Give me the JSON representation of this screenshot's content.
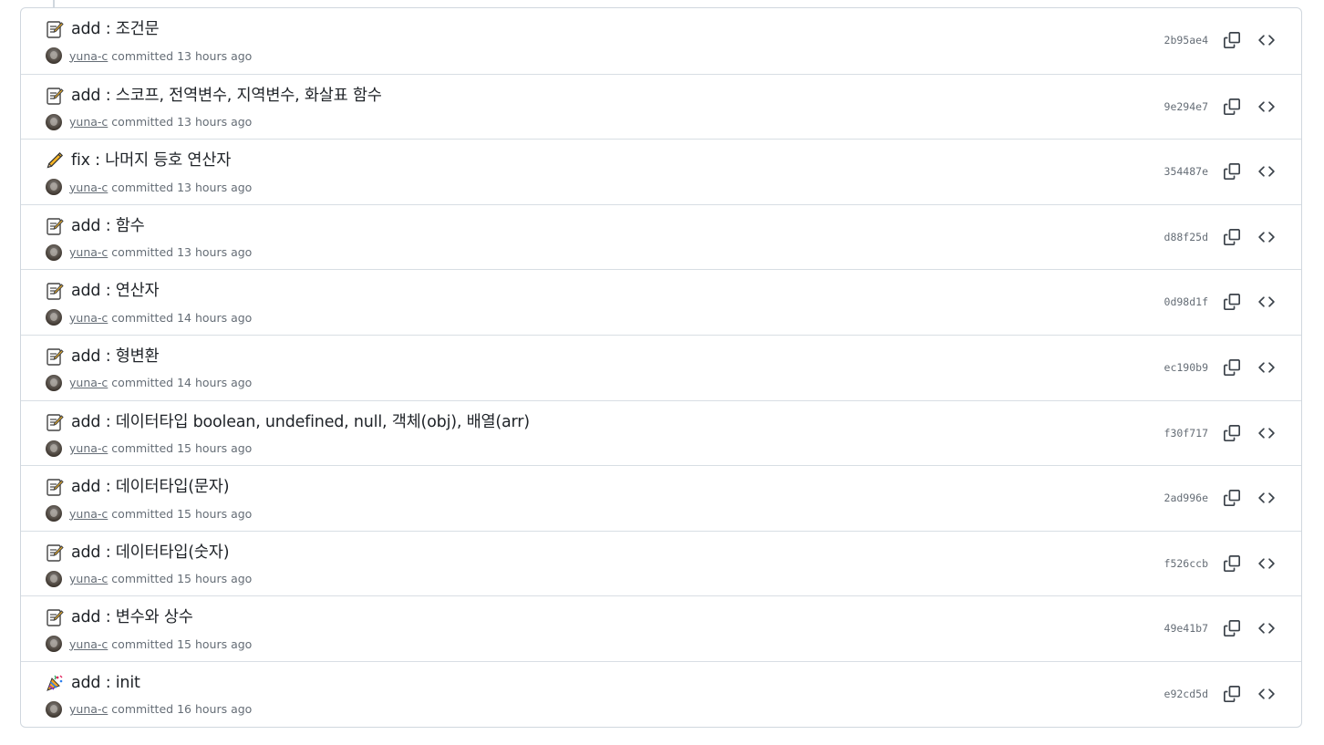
{
  "commits": [
    {
      "emoji": "memo-icon",
      "title": "add : 조건문",
      "author": "yuna-c",
      "verb": "committed",
      "time": "13 hours ago",
      "sha": "2b95ae4"
    },
    {
      "emoji": "memo-icon",
      "title": "add : 스코프, 전역변수, 지역변수, 화살표 함수",
      "author": "yuna-c",
      "verb": "committed",
      "time": "13 hours ago",
      "sha": "9e294e7"
    },
    {
      "emoji": "pencil-icon",
      "title": "fix : 나머지 등호 연산자",
      "author": "yuna-c",
      "verb": "committed",
      "time": "13 hours ago",
      "sha": "354487e"
    },
    {
      "emoji": "memo-icon",
      "title": "add : 함수",
      "author": "yuna-c",
      "verb": "committed",
      "time": "13 hours ago",
      "sha": "d88f25d"
    },
    {
      "emoji": "memo-icon",
      "title": "add : 연산자",
      "author": "yuna-c",
      "verb": "committed",
      "time": "14 hours ago",
      "sha": "0d98d1f"
    },
    {
      "emoji": "memo-icon",
      "title": "add : 형변환",
      "author": "yuna-c",
      "verb": "committed",
      "time": "14 hours ago",
      "sha": "ec190b9"
    },
    {
      "emoji": "memo-icon",
      "title": "add : 데이터타입 boolean, undefined, null, 객체(obj), 배열(arr)",
      "author": "yuna-c",
      "verb": "committed",
      "time": "15 hours ago",
      "sha": "f30f717"
    },
    {
      "emoji": "memo-icon",
      "title": "add : 데이터타입(문자)",
      "author": "yuna-c",
      "verb": "committed",
      "time": "15 hours ago",
      "sha": "2ad996e"
    },
    {
      "emoji": "memo-icon",
      "title": "add : 데이터타입(숫자)",
      "author": "yuna-c",
      "verb": "committed",
      "time": "15 hours ago",
      "sha": "f526ccb"
    },
    {
      "emoji": "memo-icon",
      "title": "add : 변수와 상수",
      "author": "yuna-c",
      "verb": "committed",
      "time": "15 hours ago",
      "sha": "49e41b7"
    },
    {
      "emoji": "party-popper-icon",
      "title": "add : init",
      "author": "yuna-c",
      "verb": "committed",
      "time": "16 hours ago",
      "sha": "e92cd5d"
    }
  ],
  "icons": {
    "copy": "copy-icon",
    "browse": "code-icon"
  },
  "colors": {
    "border": "#d0d7de",
    "text": "#1f2328",
    "muted": "#656d76",
    "link": "#0969da"
  }
}
